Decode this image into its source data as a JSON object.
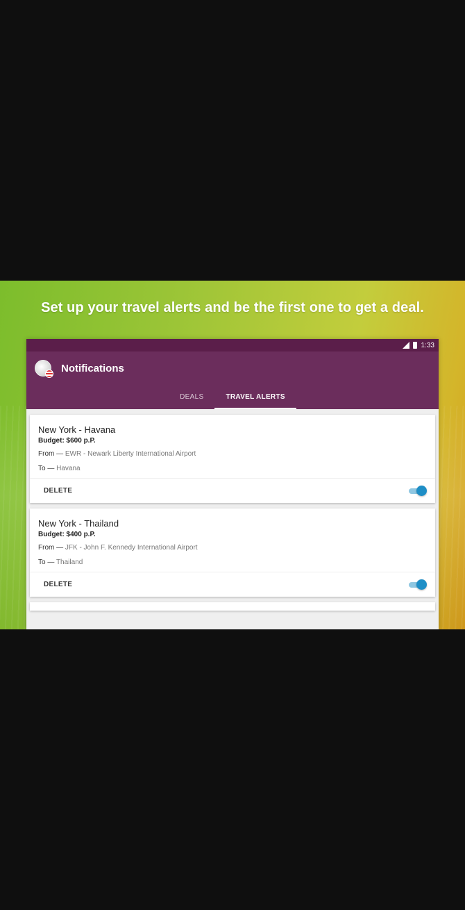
{
  "banner": {
    "headline": "Set up your travel alerts and be the first one to get a deal."
  },
  "status_bar": {
    "time": "1:33"
  },
  "app_bar": {
    "title": "Notifications",
    "tabs": [
      {
        "label": "DEALS",
        "active": false
      },
      {
        "label": "TRAVEL ALERTS",
        "active": true
      }
    ]
  },
  "alerts": [
    {
      "title": "New York - Havana",
      "budget": "Budget: $600 p.P.",
      "from_label": "From —",
      "from_value": "EWR - Newark Liberty International Airport",
      "to_label": "To —",
      "to_value": "Havana",
      "delete_label": "DELETE",
      "enabled": true
    },
    {
      "title": "New York - Thailand",
      "budget": "Budget: $400 p.P.",
      "from_label": "From —",
      "from_value": "JFK - John F. Kennedy International Airport",
      "to_label": "To —",
      "to_value": "Thailand",
      "delete_label": "DELETE",
      "enabled": true
    }
  ],
  "colors": {
    "status_bar": "#5b1e4a",
    "app_bar": "#6b2d5c",
    "toggle_on": "#1e8ec6"
  }
}
